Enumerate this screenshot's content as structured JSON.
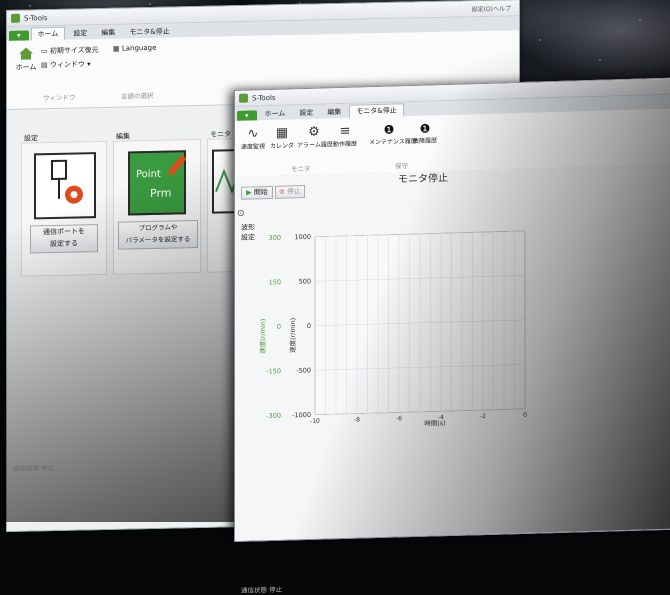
{
  "back_window": {
    "title": "S-Tools",
    "title_right": "設定(O)ヘルプ",
    "tabs": [
      "ホーム",
      "設定",
      "編集",
      "モニタ&停止"
    ],
    "ribbon": {
      "home_label": "ホーム",
      "initial_size": "初期サイズ復元",
      "window": "ウィンドウ",
      "language": "Language",
      "group_window": "ウィンドウ",
      "group_lang": "言語の選択"
    },
    "cards": [
      {
        "header": "設定",
        "button": "通信ポートを\n設定する"
      },
      {
        "header": "編集",
        "icon_top": "Point",
        "icon_bottom": "Prm",
        "button": "プログラムや\nパラメータを設定する"
      },
      {
        "header": "モニタ"
      }
    ],
    "bottom_bar": "通信状態 停止"
  },
  "front_window": {
    "title": "S-Tools",
    "tabs": [
      "ホーム",
      "設定",
      "編集",
      "モニタ&停止"
    ],
    "ribbon_items": [
      "速度監視",
      "カレンダ",
      "アラーム履歴",
      "動作履歴",
      "メンテナンス履歴",
      "故障履歴"
    ],
    "group_monitor": "モニタ",
    "group_maint": "保守",
    "start_button": "開始",
    "stop_button": "停止",
    "side_labels": [
      "波形",
      "設定"
    ],
    "bottom_bar": "通信状態 停止"
  },
  "chart_data": {
    "type": "line",
    "title": "モニタ停止",
    "y1_ticks": [
      "300",
      "150",
      "0",
      "-150",
      "-300"
    ],
    "y2_ticks": [
      "1000",
      "500",
      "0",
      "-500",
      "-1000"
    ],
    "x_ticks": [
      "-10",
      "-8",
      "-6",
      "-4",
      "-2",
      "0"
    ],
    "y1_label": "速度(r/min)",
    "y2_label": "速度(r/min)",
    "xlabel": "時間(s)",
    "ylim_left": [
      -300,
      300
    ],
    "ylim_right": [
      -1000,
      1000
    ],
    "xlim": [
      -10,
      0
    ],
    "series": [],
    "grid": true
  },
  "colors": {
    "brand_green": "#3f9b2e",
    "axis_green": "#4a9a3a"
  }
}
